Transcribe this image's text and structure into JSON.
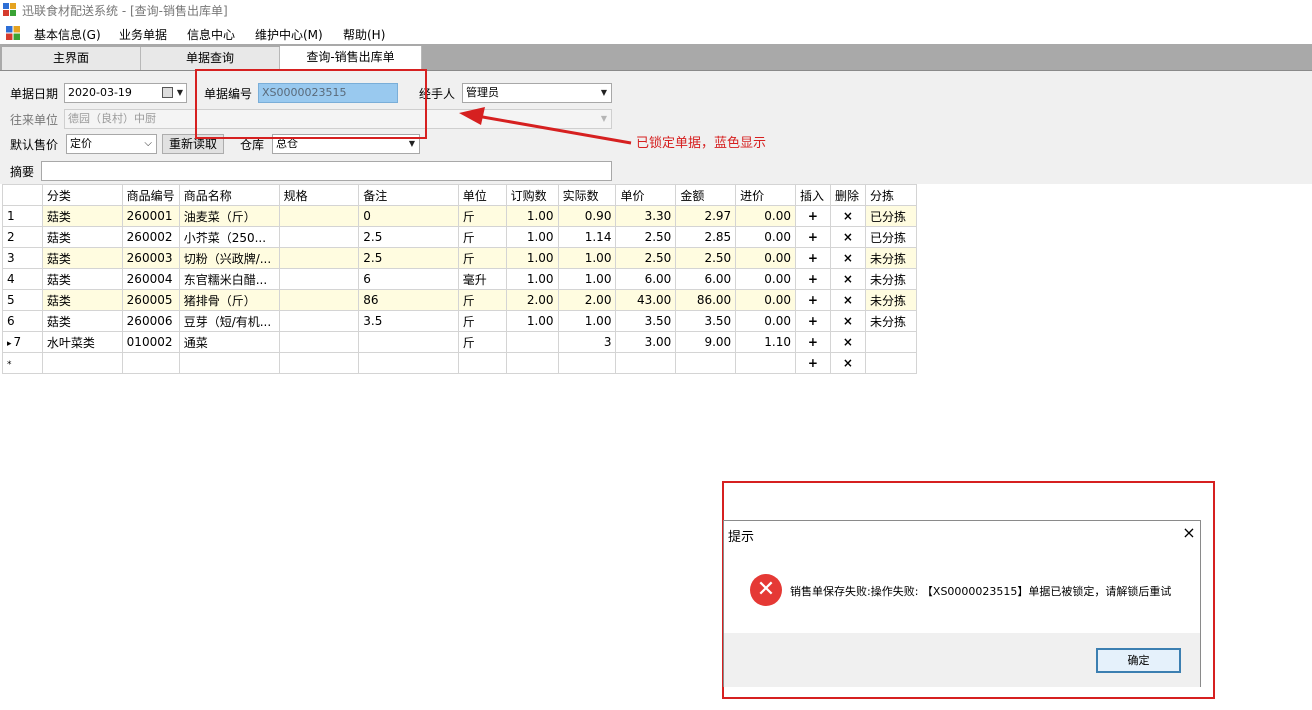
{
  "window": {
    "title": "迅联食材配送系统 - [查询-销售出库单]",
    "icon": "app-grid-icon"
  },
  "menu": [
    "基本信息(G)",
    "业务单据",
    "信息中心",
    "维护中心(M)",
    "帮助(H)"
  ],
  "tabs": [
    "主界面",
    "单据查询",
    "查询-销售出库单"
  ],
  "form": {
    "date_label": "单据日期",
    "date_value": "2020-03-19",
    "docno_label": "单据编号",
    "docno_value": "XS0000023515",
    "handler_label": "经手人",
    "handler_value": "管理员",
    "partner_label": "往来单位",
    "partner_value": "德园（良村）中厨",
    "price_label": "默认售价",
    "price_value": "定价",
    "reload_label": "重新读取",
    "warehouse_label": "仓库",
    "warehouse_value": "总仓",
    "summary_label": "摘要",
    "summary_value": ""
  },
  "annotation": {
    "text": "已锁定单据，蓝色显示",
    "color": "#d62020"
  },
  "grid": {
    "columns": [
      "分类",
      "商品编号",
      "商品名称",
      "规格",
      "备注",
      "单位",
      "订购数",
      "实际数",
      "单价",
      "金额",
      "进价",
      "插入",
      "删除",
      "分拣"
    ],
    "rows": [
      {
        "no": "1",
        "cells": [
          "菇类",
          "260001",
          "油麦菜（斤）",
          "",
          "0",
          "斤",
          "1.00",
          "0.90",
          "3.30",
          "2.97",
          "0.00",
          "+",
          "×",
          "已分拣"
        ]
      },
      {
        "no": "2",
        "cells": [
          "菇类",
          "260002",
          "小芥菜（250...",
          "",
          "2.5",
          "斤",
          "1.00",
          "1.14",
          "2.50",
          "2.85",
          "0.00",
          "+",
          "×",
          "已分拣"
        ]
      },
      {
        "no": "3",
        "cells": [
          "菇类",
          "260003",
          "切粉（兴政牌/...",
          "",
          "2.5",
          "斤",
          "1.00",
          "1.00",
          "2.50",
          "2.50",
          "0.00",
          "+",
          "×",
          "未分拣"
        ]
      },
      {
        "no": "4",
        "cells": [
          "菇类",
          "260004",
          "东官糯米白醋...",
          "",
          "6",
          "毫升",
          "1.00",
          "1.00",
          "6.00",
          "6.00",
          "0.00",
          "+",
          "×",
          "未分拣"
        ]
      },
      {
        "no": "5",
        "cells": [
          "菇类",
          "260005",
          "猪排骨（斤）",
          "",
          "86",
          "斤",
          "2.00",
          "2.00",
          "43.00",
          "86.00",
          "0.00",
          "+",
          "×",
          "未分拣"
        ]
      },
      {
        "no": "6",
        "cells": [
          "菇类",
          "260006",
          "豆芽（短/有机...",
          "",
          "3.5",
          "斤",
          "1.00",
          "1.00",
          "3.50",
          "3.50",
          "0.00",
          "+",
          "×",
          "未分拣"
        ]
      },
      {
        "no": "7",
        "cells": [
          "水叶菜类",
          "010002",
          "通菜",
          "",
          "",
          "斤",
          "",
          "3",
          "3.00",
          "9.00",
          "1.10",
          "+",
          "×",
          ""
        ]
      },
      {
        "no": "*",
        "cells": [
          "",
          "",
          "",
          "",
          "",
          "",
          "",
          "",
          "",
          "",
          "",
          "+",
          "×",
          ""
        ]
      }
    ]
  },
  "dialog": {
    "title": "提示",
    "close": "×",
    "icon": "error-icon",
    "icon_glyph": "✕",
    "message": "销售单保存失败:操作失败: 【XS0000023515】单据已被锁定，请解锁后重试",
    "ok_label": "确定"
  }
}
